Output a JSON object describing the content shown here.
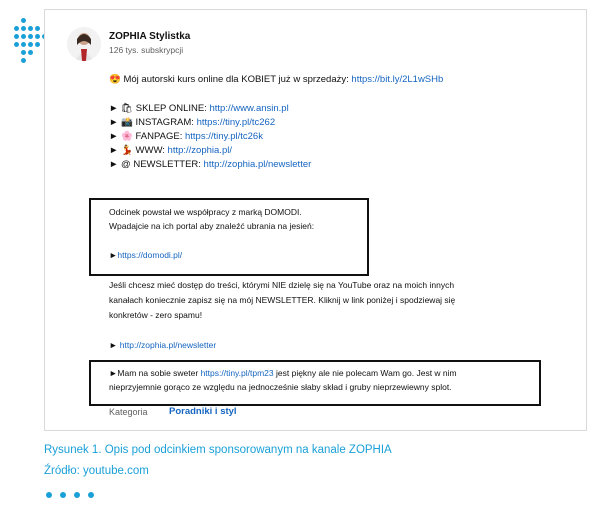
{
  "channel": {
    "name": "ZOPHIA Stylistka",
    "subscribers": "126 tys. subskrypcji"
  },
  "description": {
    "promo": {
      "emoji": "😍",
      "text": "Mój autorski kurs online dla KOBIET już w sprzedaży: ",
      "url": "https://bit.ly/2L1wSHb"
    },
    "links": [
      {
        "emoji": "🛍",
        "label": "SKLEP ONLINE:  ",
        "url": "http://www.ansin.pl"
      },
      {
        "emoji": "📸",
        "label": "INSTAGRAM: ",
        "url": "https://tiny.pl/tc262"
      },
      {
        "emoji": "🌸",
        "label": "FANPAGE: ",
        "url": "https://tiny.pl/tc26k"
      },
      {
        "emoji": "💃",
        "label": "WWW: ",
        "url": "http://zophia.pl/"
      },
      {
        "emoji": "@",
        "label": "NEWSLETTER: ",
        "url": "http://zophia.pl/newsletter"
      }
    ],
    "sponsor_box": {
      "line1": "Odcinek powstał we współpracy z marką DOMODI.",
      "line2": "Wpadajcie na ich portal aby znaleźć ubrania na jesień:",
      "arrow": "►",
      "url": "https://domodi.pl/"
    },
    "newsletter_text": {
      "line1": "Jeśli chcesz mieć dostęp do treści, którymi NIE dzielę się na YouTube oraz na moich innych",
      "line2": "kanałach koniecznie zapisz się na mój NEWSLETTER. Kliknij w link poniżej i spodziewaj się",
      "line3": "konkretów - zero spamu!"
    },
    "newsletter_link": {
      "arrow": "►",
      "url": "http://zophia.pl/newsletter"
    },
    "sweater_box": {
      "prefix": "►Mam na sobie sweter ",
      "url": "https://tiny.pl/tpm23",
      "suffix": " jest piękny ale nie polecam Wam go. Jest w nim",
      "line2": "nieprzyjemnie gorąco ze względu na jednocześnie słaby skład i gruby nieprzewiewny splot."
    },
    "category": {
      "label": "Kategoria",
      "value": "Poradniki i styl"
    }
  },
  "caption": {
    "figure": "Rysunek 1. Opis pod odcinkiem sponsorowanym na kanale ZOPHIA",
    "source": "Źródło: youtube.com"
  },
  "colors": {
    "accent": "#1aa0d8",
    "link": "#1565c0"
  }
}
